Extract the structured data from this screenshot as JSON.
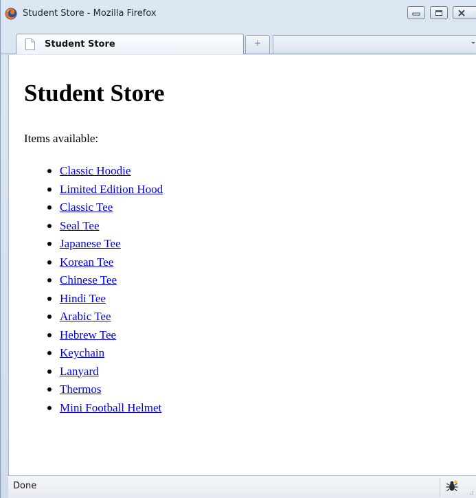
{
  "window": {
    "title": "Student Store - Mozilla Firefox",
    "icons": [
      "firefox-icon",
      "minimize-icon",
      "maximize-icon",
      "close-icon"
    ]
  },
  "tabs": [
    {
      "label": "Student Store",
      "active": true,
      "icon": "page-icon"
    }
  ],
  "newtab_symbol": "+",
  "page": {
    "title": "Student Store",
    "intro": "Items available:",
    "items": [
      "Classic Hoodie",
      "Limited Edition Hood",
      "Classic Tee",
      "Seal Tee",
      "Japanese Tee",
      "Korean Tee",
      "Chinese Tee",
      "Hindi Tee",
      "Arabic Tee",
      "Hebrew Tee",
      "Keychain",
      "Lanyard",
      "Thermos",
      "Mini Football Helmet"
    ],
    "link_color": "#0000ee"
  },
  "status": {
    "text": "Done",
    "icon": "bug-icon"
  }
}
